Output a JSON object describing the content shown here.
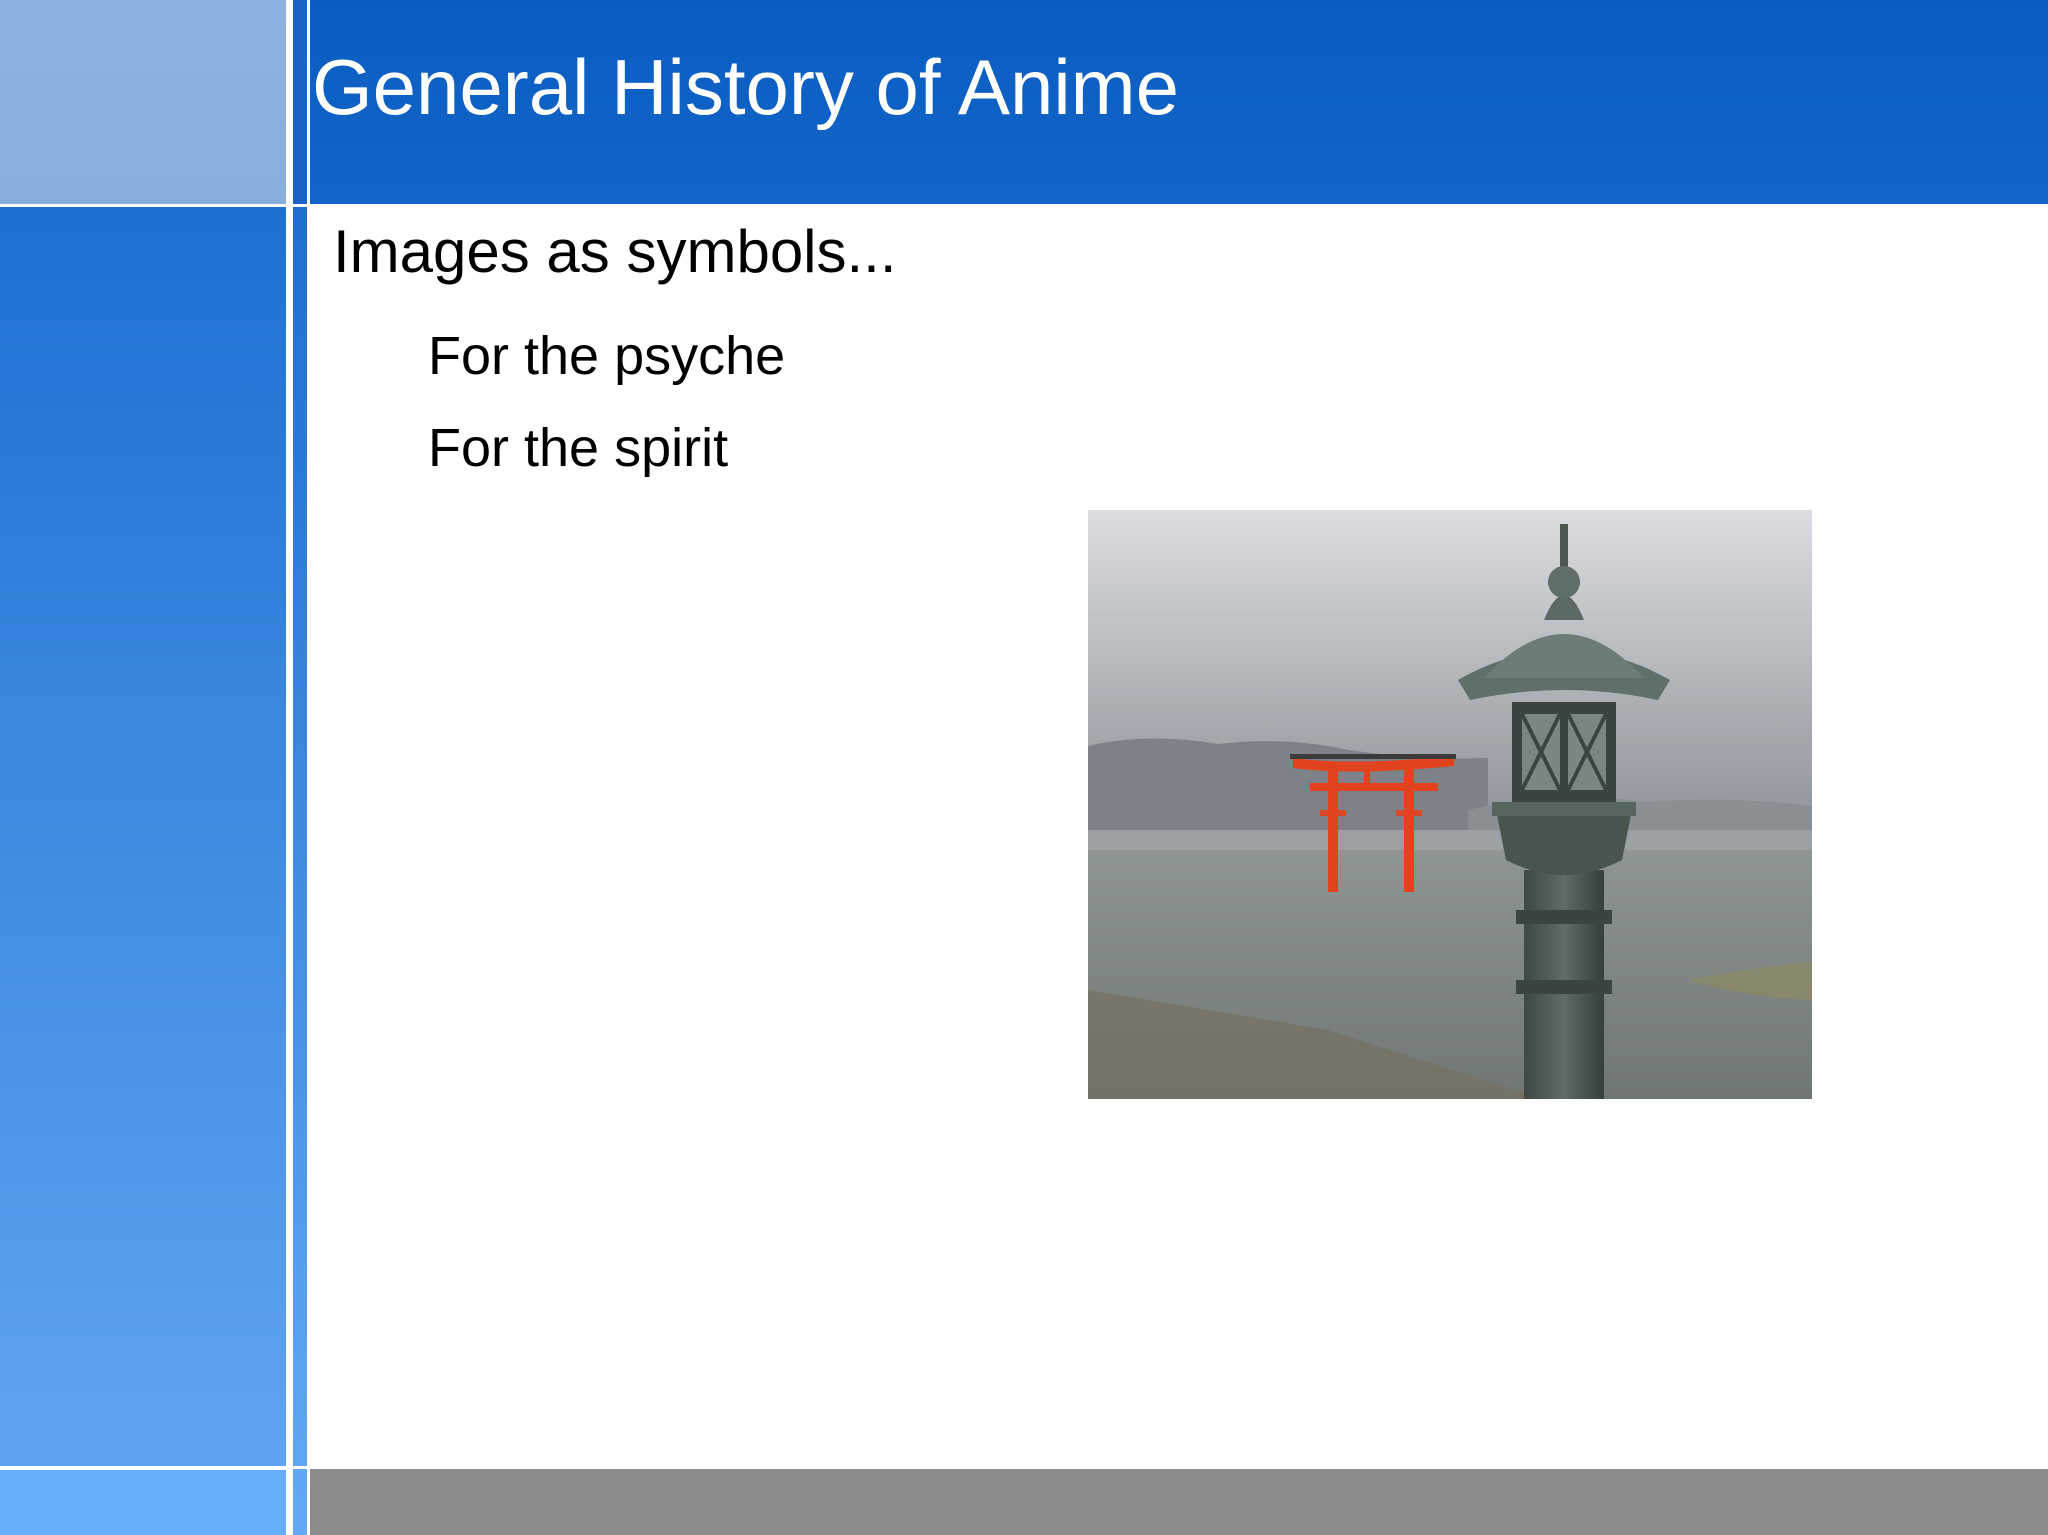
{
  "slide": {
    "title": "General History of Anime",
    "heading": "Images as symbols...",
    "bullets": [
      "For the psyche",
      "For the spirit"
    ]
  },
  "photo": {
    "subject": "torii-gate-and-stone-lantern-photo"
  },
  "colors": {
    "header": "#0a5cc0",
    "sidebar": "#3a86e0",
    "footer": "#8b8b8d",
    "torii": "#e2431f"
  }
}
